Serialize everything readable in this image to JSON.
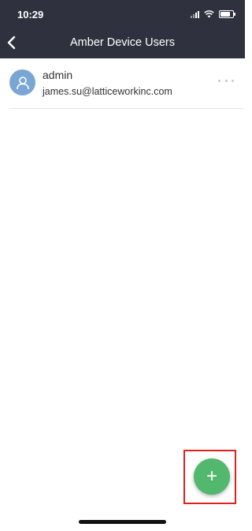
{
  "status_bar": {
    "time": "10:29"
  },
  "header": {
    "title": "Amber Device Users"
  },
  "users": [
    {
      "name": "admin",
      "email": "james.su@latticeworkinc.com"
    }
  ],
  "fab": {
    "icon": "plus-icon",
    "symbol": "+",
    "color": "#52b86e"
  },
  "colors": {
    "header_bg": "#2f323e",
    "avatar_bg": "#7aa6d4",
    "highlight": "#e02020"
  }
}
